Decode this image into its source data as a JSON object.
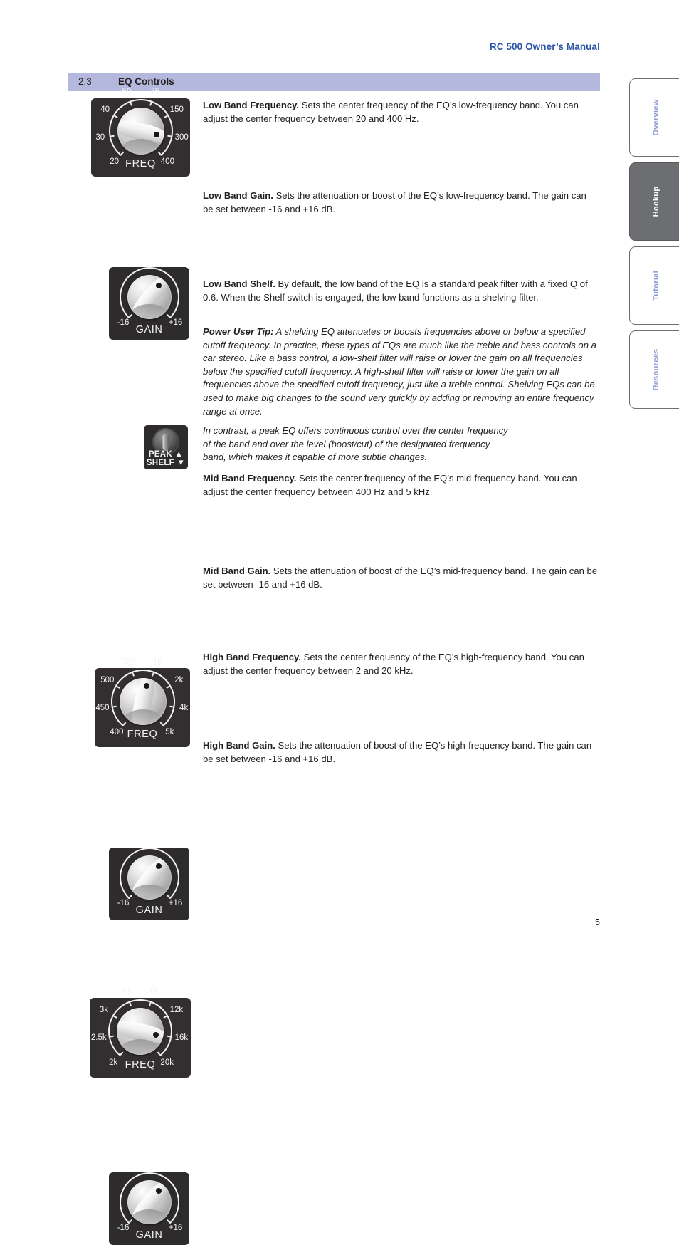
{
  "header": {
    "title": "RC 500 Owner’s Manual"
  },
  "section": {
    "number": "2.3",
    "title": "EQ Controls"
  },
  "side_tabs": [
    {
      "label": "Overview",
      "active": false
    },
    {
      "label": "Hookup",
      "active": true
    },
    {
      "label": "Tutorial",
      "active": false
    },
    {
      "label": "Resources",
      "active": false
    }
  ],
  "entries": {
    "low_freq": {
      "term": "Low Band Frequency.",
      "text": " Sets the center frequency of the EQ’s low-frequency band. You can adjust the center frequency between 20 and 400 Hz."
    },
    "low_gain": {
      "term": "Low Band Gain.",
      "text": " Sets the attenuation or boost of the EQ’s low-frequency band. The gain can be set between -16 and +16 dB."
    },
    "low_shelf": {
      "term": "Low Band Shelf.",
      "text": " By default, the low band of the EQ is a standard peak filter with a fixed Q of 0.6. When the Shelf switch is engaged, the low band functions as a shelving filter."
    },
    "tip": {
      "term": "Power User Tip:",
      "text": " A shelving EQ attenuates or boosts frequencies above or below a specified cutoff frequency. In practice, these types of EQs are much like the treble and bass controls on a car stereo. Like a bass control, a low-shelf filter will raise or lower the gain on all frequencies below the specified cutoff frequency. A high-shelf filter will raise or lower the gain on all frequencies above the specified cutoff frequency, just like a treble control. Shelving EQs can be used to make big changes to the sound very quickly by adding or removing an entire frequency range at once."
    },
    "tip2": {
      "text": "In contrast, a peak EQ offers continuous control over the center frequency of the band and over the level (boost/cut) of the designated frequency band, which makes it capable of more subtle changes."
    },
    "mid_freq": {
      "term": "Mid Band Frequency.",
      "text": " Sets the center frequency of the EQ’s mid-frequency band. You can adjust the center frequency between 400 Hz and 5 kHz."
    },
    "mid_gain": {
      "term": "Mid Band Gain.",
      "text": " Sets the attenuation of boost of the EQ’s mid-frequency band. The gain can be set between -16 and +16 dB."
    },
    "high_freq": {
      "term": "High Band Frequency.",
      "text": " Sets the center frequency of the EQ’s high-frequency band. You can adjust the center frequency between 2 and 20 kHz."
    },
    "high_gain": {
      "term": "High Band Gain.",
      "text": " Sets the attenuation of boost of the EQ’s high-frequency band. The gain can be set between -16 and +16 dB."
    }
  },
  "knobs": {
    "low_freq": {
      "caption": "FREQ",
      "labels": [
        "20",
        "30",
        "40",
        "50",
        "75",
        "150",
        "300",
        "400"
      ],
      "pointer_value": "300"
    },
    "low_gain": {
      "caption": "GAIN",
      "labels": [
        "-16",
        "+16"
      ],
      "pointer_value": "+8"
    },
    "mid_freq": {
      "caption": "FREQ",
      "labels": [
        "400",
        "450",
        "500",
        "700",
        "1k",
        "2k",
        "4k",
        "5k"
      ],
      "pointer_value": "1k"
    },
    "mid_gain": {
      "caption": "GAIN",
      "labels": [
        "-16",
        "+16"
      ],
      "pointer_value": "+8"
    },
    "high_freq": {
      "caption": "FREQ",
      "labels": [
        "2k",
        "2.5k",
        "3k",
        "4k",
        "6k",
        "12k",
        "16k",
        "20k"
      ],
      "pointer_value": "16k"
    },
    "high_gain": {
      "caption": "GAIN",
      "labels": [
        "-16",
        "+16"
      ],
      "pointer_value": "+8"
    }
  },
  "switch": {
    "line1": "PEAK ▲",
    "line2": "SHELF ▼"
  },
  "footer": {
    "page_number": "5"
  },
  "colors": {
    "accent_blue": "#2b55a5",
    "section_bar": "#b4b8dd",
    "tab_label": "#8e9bd4",
    "tab_active_bg": "#6d6e71",
    "panel_dark": "#2e2b2c"
  }
}
